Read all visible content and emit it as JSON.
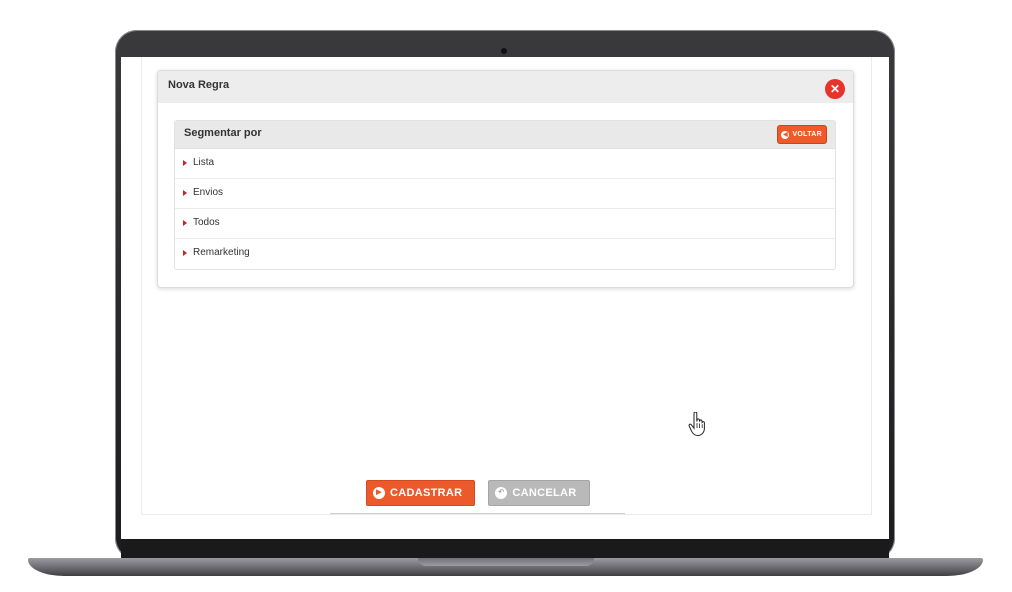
{
  "modal": {
    "title": "Nova Regra",
    "close_icon": "close-icon"
  },
  "segment_panel": {
    "title": "Segmentar por",
    "back_label": "VOLTAR",
    "back_icon": "back-arrow-icon",
    "items": [
      {
        "label": "Lista"
      },
      {
        "label": "Envios"
      },
      {
        "label": "Todos"
      },
      {
        "label": "Remarketing"
      }
    ]
  },
  "actions": {
    "submit_label": "CADASTRAR",
    "submit_icon": "play-icon",
    "cancel_label": "CANCELAR",
    "cancel_icon": "undo-icon"
  },
  "colors": {
    "accent": "#ec5a2c",
    "close": "#e8322c",
    "arrow": "#d41f1f",
    "cancel": "#b9b9b9"
  }
}
